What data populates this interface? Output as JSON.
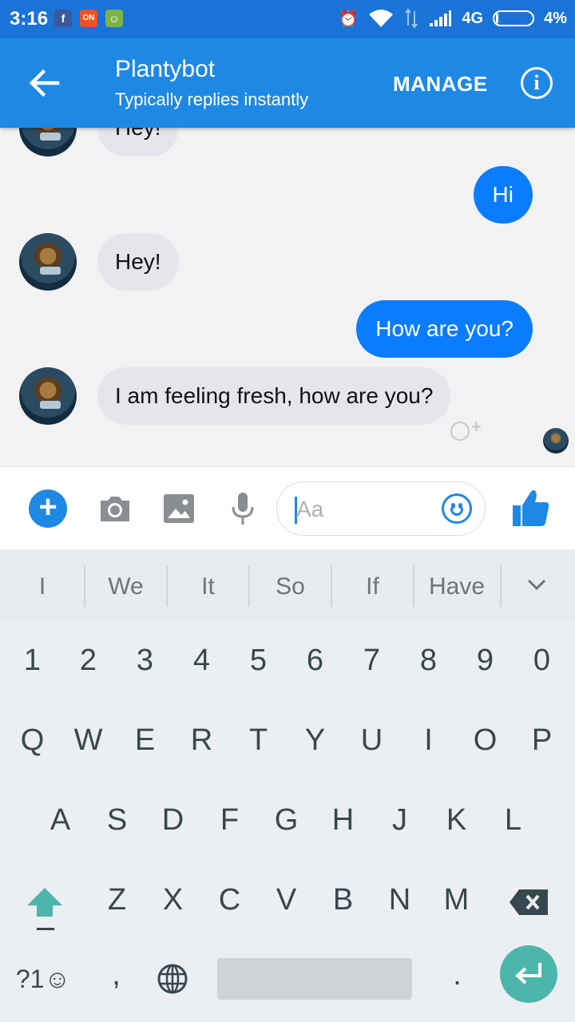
{
  "status_bar": {
    "time": "3:16",
    "network": "4G",
    "battery": "4%",
    "battery_level": 0.04
  },
  "header": {
    "title": "Plantybot",
    "subtitle": "Typically replies instantly",
    "manage_label": "MANAGE",
    "info_glyph": "i",
    "back_icon": "arrow-back-icon"
  },
  "messages": [
    {
      "from": "bot",
      "text": "Hey!"
    },
    {
      "from": "me",
      "text": "Hi"
    },
    {
      "from": "bot",
      "text": "Hey!"
    },
    {
      "from": "me",
      "text": "How are you?"
    },
    {
      "from": "bot",
      "text": "I am feeling fresh, how are you?"
    }
  ],
  "composer": {
    "placeholder": "Aa",
    "value": "",
    "icons": [
      "plus-icon",
      "camera-icon",
      "image-icon",
      "microphone-icon",
      "emoji-icon",
      "thumbs-up-icon"
    ]
  },
  "suggestions": [
    "I",
    "We",
    "It",
    "So",
    "If",
    "Have"
  ],
  "keyboard": {
    "number_row": [
      "1",
      "2",
      "3",
      "4",
      "5",
      "6",
      "7",
      "8",
      "9",
      "0"
    ],
    "row1": [
      "Q",
      "W",
      "E",
      "R",
      "T",
      "Y",
      "U",
      "I",
      "O",
      "P"
    ],
    "row2": [
      "A",
      "S",
      "D",
      "F",
      "G",
      "H",
      "J",
      "K",
      "L"
    ],
    "row3": [
      "Z",
      "X",
      "C",
      "V",
      "B",
      "N",
      "M"
    ],
    "symbols_label": "?1☺",
    "comma": ",",
    "period": "."
  },
  "colors": {
    "status_bar": "#1a73d6",
    "app_bar": "#1e88e5",
    "outgoing_bubble": "#0a7cff",
    "incoming_bubble": "#e4e6eb",
    "enter_key": "#4db6ac"
  }
}
